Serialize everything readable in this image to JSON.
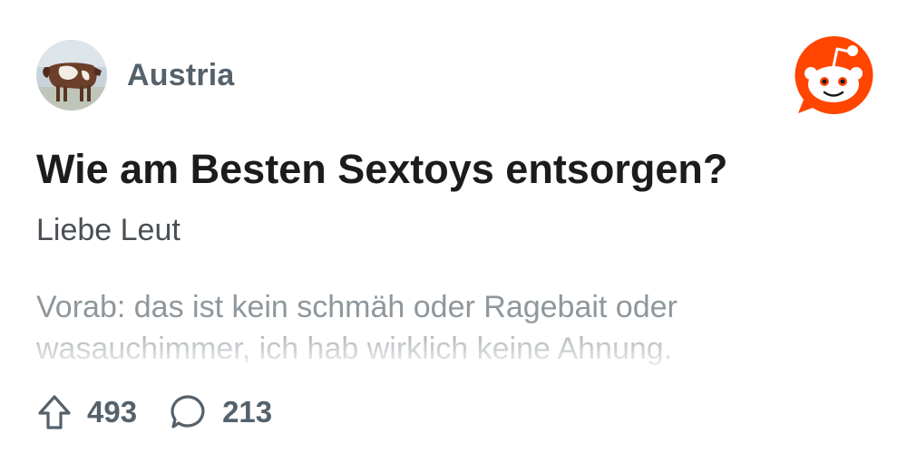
{
  "post": {
    "community": "Austria",
    "title": "Wie am Besten Sextoys entsorgen?",
    "subtitle": "Liebe Leut",
    "body_preview": "Vorab: das ist kein schmäh oder Ragebait oder wasauchimmer, ich hab wirklich keine Ahnung.",
    "upvotes": "493",
    "comments": "213"
  },
  "icons": {
    "avatar": "cow-avatar",
    "logo": "reddit-logo-icon",
    "upvote": "upvote-arrow-icon",
    "comment": "comment-bubble-icon"
  },
  "colors": {
    "brand": "#ff4500",
    "title": "#1c1c1c",
    "meta": "#55616b",
    "muted": "#8f979c"
  }
}
